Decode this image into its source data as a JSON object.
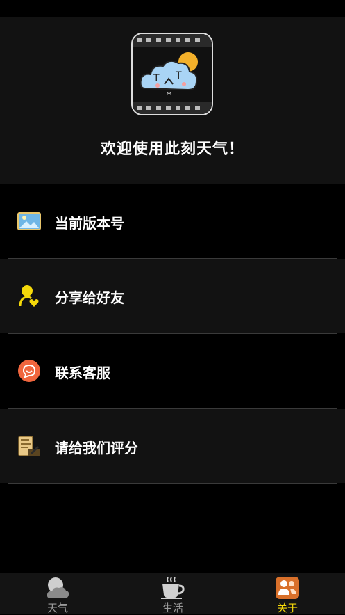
{
  "header": {
    "welcome": "欢迎使用此刻天气！",
    "logo_text": "T^T"
  },
  "menu": [
    {
      "label": "当前版本号",
      "icon": "landscape-picture-icon"
    },
    {
      "label": "分享给好友",
      "icon": "user-heart-icon"
    },
    {
      "label": "联系客服",
      "icon": "chat-smile-icon"
    },
    {
      "label": "请给我们评分",
      "icon": "rating-document-icon"
    }
  ],
  "tabs": [
    {
      "label": "天气",
      "icon": "cloud-moon-icon",
      "active": false
    },
    {
      "label": "生活",
      "icon": "coffee-cup-icon",
      "active": false
    },
    {
      "label": "关于",
      "icon": "users-icon",
      "active": true
    }
  ],
  "colors": {
    "background": "#000000",
    "header_bg": "#121212",
    "active_tab": "#f5d90a",
    "divider": "#3a3a3a"
  }
}
